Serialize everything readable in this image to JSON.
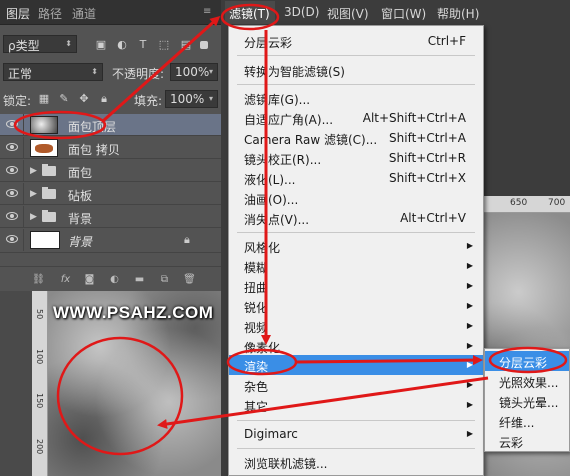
{
  "panel": {
    "tabs": [
      "图层",
      "路径",
      "通道"
    ],
    "filter_kind": "ρ类型",
    "blend_mode": "正常",
    "opacity_label": "不透明度:",
    "opacity_value": "100%",
    "lock_label": "锁定:",
    "fill_label": "填充:",
    "fill_value": "100%",
    "layers": [
      {
        "name": "面包顶层",
        "thumb": "clouds",
        "selected": true
      },
      {
        "name": "面包 拷贝",
        "thumb": "bread",
        "selected": false
      },
      {
        "name": "面包",
        "thumb": "folder",
        "selected": false
      },
      {
        "name": "砧板",
        "thumb": "folder",
        "selected": false
      },
      {
        "name": "背景",
        "thumb": "folder",
        "selected": false
      },
      {
        "name": "背景",
        "thumb": "white",
        "selected": false,
        "locked": true
      }
    ],
    "bottom_icons": [
      "link-icon",
      "fx-icon",
      "mask-icon",
      "adjustment-icon",
      "group-icon",
      "new-layer-icon",
      "trash-icon"
    ]
  },
  "menubar": {
    "items": [
      "滤镜(T)",
      "3D(D)",
      "视图(V)",
      "窗口(W)",
      "帮助(H)"
    ]
  },
  "filter_menu": {
    "items": [
      {
        "label": "分层云彩",
        "shortcut": "Ctrl+F"
      },
      {
        "label": "转换为智能滤镜(S)",
        "shortcut": ""
      },
      {
        "label": "滤镜库(G)...",
        "shortcut": ""
      },
      {
        "label": "自适应广角(A)...",
        "shortcut": "Alt+Shift+Ctrl+A"
      },
      {
        "label": "Camera Raw 滤镜(C)...",
        "shortcut": "Shift+Ctrl+A"
      },
      {
        "label": "镜头校正(R)...",
        "shortcut": "Shift+Ctrl+R"
      },
      {
        "label": "液化(L)...",
        "shortcut": "Shift+Ctrl+X"
      },
      {
        "label": "油画(O)...",
        "shortcut": ""
      },
      {
        "label": "消失点(V)...",
        "shortcut": "Alt+Ctrl+V"
      },
      {
        "label": "风格化",
        "shortcut": ""
      },
      {
        "label": "模糊",
        "shortcut": ""
      },
      {
        "label": "扭曲",
        "shortcut": ""
      },
      {
        "label": "锐化",
        "shortcut": ""
      },
      {
        "label": "视频",
        "shortcut": ""
      },
      {
        "label": "像素化",
        "shortcut": ""
      },
      {
        "label": "渲染",
        "shortcut": ""
      },
      {
        "label": "杂色",
        "shortcut": ""
      },
      {
        "label": "其它",
        "shortcut": ""
      },
      {
        "label": "Digimarc",
        "shortcut": ""
      },
      {
        "label": "浏览联机滤镜...",
        "shortcut": ""
      }
    ]
  },
  "render_submenu": {
    "items": [
      "分层云彩",
      "光照效果...",
      "镜头光晕...",
      "纤维...",
      "云彩"
    ]
  },
  "ruler": {
    "top_labels": [
      "650",
      "700"
    ],
    "left_labels": [
      "50",
      "100",
      "150",
      "200"
    ]
  },
  "watermark": "WWW.PSAHZ.COM",
  "colors": {
    "menu_highlight": "#3a8ee6",
    "annotation_red": "#e01818",
    "panel_bg": "#535353",
    "selected_layer": "#6a7488"
  }
}
